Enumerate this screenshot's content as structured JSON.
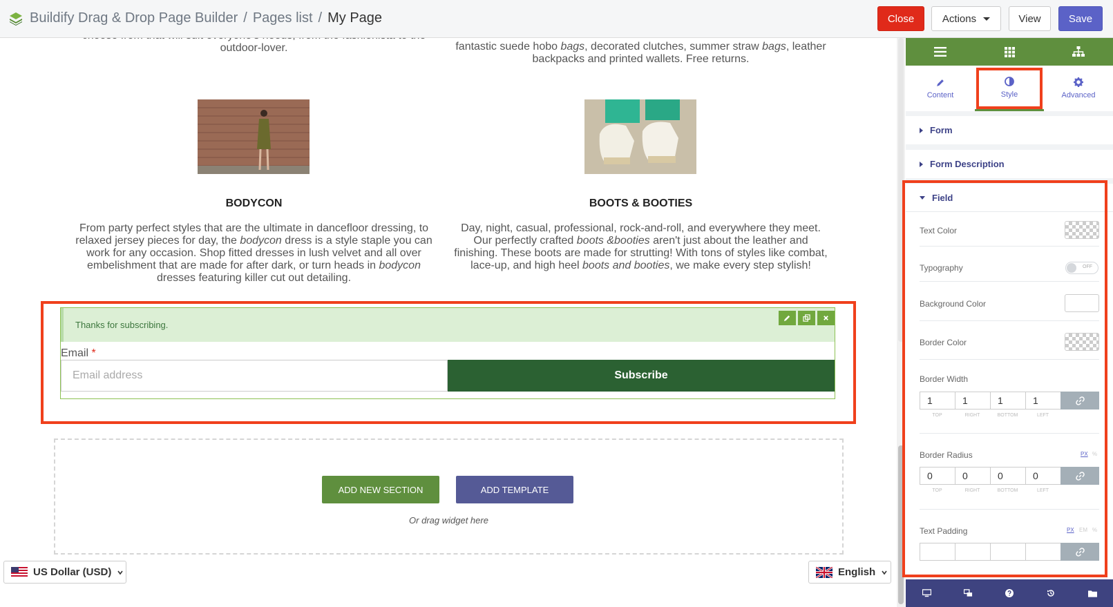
{
  "topbar": {
    "app_title": "Buildify Drag & Drop Page Builder",
    "separator": "/",
    "crumb_pages": "Pages list",
    "crumb_current": "My Page",
    "close_label": "Close",
    "actions_label": "Actions",
    "view_label": "View",
    "save_label": "Save"
  },
  "canvas": {
    "top_left_text": "choose from that will suit everyone's needs, from the fashionista to the outdoor-lover.",
    "top_right_text_html": "fantastic suede hobo <i>bags</i>, decorated clutches, summer straw <i>bags</i>, leather backpacks and printed wallets. Free returns.",
    "products": [
      {
        "title": "BODYCON",
        "image_icon": "woman-in-dress-photo",
        "description_html": "From party perfect styles that are the ultimate in dancefloor dressing, to relaxed jersey pieces for day, the <i>bodycon</i> dress is a style staple you can work for any occasion. Shop fitted dresses in lush velvet and all over embelishment that are made for after dark, or turn heads in <i>bodycon</i> dresses featuring killer cut out detailing."
      },
      {
        "title": "BOOTS & BOOTIES",
        "image_icon": "platform-shoes-photo",
        "description_html": "Day, night, casual, professional, rock-and-roll, and everywhere they meet. Our perfectly crafted <i>boots &amp;booties</i> aren't just about the leather and finishing. These boots are made for strutting! With tons of styles like combat, lace-up, and high heel <i>boots and booties</i>, we make every step stylish!"
      }
    ],
    "form": {
      "notice": "Thanks for subscribing.",
      "email_label": "Email",
      "required_mark": "*",
      "email_placeholder": "Email address",
      "subscribe_label": "Subscribe"
    },
    "dropzone": {
      "add_section_label": "ADD NEW SECTION",
      "add_template_label": "ADD TEMPLATE",
      "hint": "Or drag widget here"
    },
    "currency_label": "US Dollar (USD)",
    "language_label": "English"
  },
  "panel": {
    "tabs": [
      {
        "label": "Content",
        "icon": "pencil-icon"
      },
      {
        "label": "Style",
        "icon": "contrast-icon"
      },
      {
        "label": "Advanced",
        "icon": "gear-icon"
      }
    ],
    "sections": {
      "form": "Form",
      "form_description": "Form Description",
      "field": "Field"
    },
    "controls": {
      "text_color": "Text Color",
      "typography": "Typography",
      "toggle_off": "OFF",
      "background_color": "Background Color",
      "border_color": "Border Color",
      "border_width": "Border Width",
      "border_width_values": [
        "1",
        "1",
        "1",
        "1"
      ],
      "border_radius": "Border Radius",
      "border_radius_values": [
        "0",
        "0",
        "0",
        "0"
      ],
      "text_padding": "Text Padding",
      "text_padding_values": [
        "",
        "",
        "",
        ""
      ],
      "dim_labels": [
        "TOP",
        "RIGHT",
        "BOTTOM",
        "LEFT"
      ],
      "unit_px": "PX",
      "unit_em": "EM",
      "unit_pct": "%"
    }
  },
  "colors": {
    "accent_green": "#5f8f3e",
    "save_purple": "#5b62c7",
    "close_red": "#e02a1a",
    "subscribe_green": "#2b6132",
    "highlight": "#f0401c"
  }
}
